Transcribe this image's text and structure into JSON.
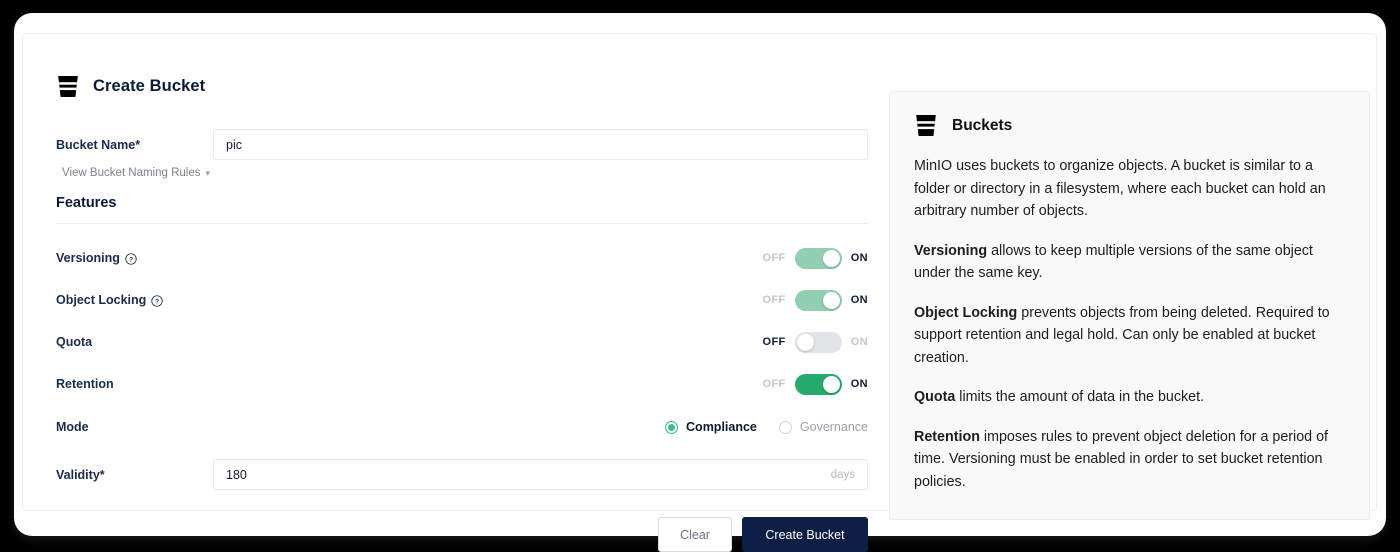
{
  "form": {
    "icon": "bucket-icon",
    "title": "Create Bucket",
    "bucket_name": {
      "label": "Bucket Name*",
      "value": "pic"
    },
    "naming_rules_link": "View Bucket Naming Rules",
    "features_title": "Features",
    "toggles": [
      {
        "label": "Versioning",
        "has_help_icon": true,
        "off_label": "OFF",
        "on_label": "ON",
        "state": "on",
        "disabled": true
      },
      {
        "label": "Object Locking",
        "has_help_icon": true,
        "off_label": "OFF",
        "on_label": "ON",
        "state": "on",
        "disabled": true
      },
      {
        "label": "Quota",
        "has_help_icon": false,
        "off_label": "OFF",
        "on_label": "ON",
        "state": "off",
        "disabled": false
      },
      {
        "label": "Retention",
        "has_help_icon": false,
        "off_label": "OFF",
        "on_label": "ON",
        "state": "on",
        "disabled": false
      }
    ],
    "mode": {
      "label": "Mode",
      "options": [
        {
          "label": "Compliance",
          "selected": true
        },
        {
          "label": "Governance",
          "selected": false
        }
      ]
    },
    "validity": {
      "label": "Validity*",
      "value": "180",
      "suffix": "days"
    },
    "buttons": {
      "clear": "Clear",
      "create": "Create Bucket"
    }
  },
  "info": {
    "icon": "bucket-icon",
    "title": "Buckets",
    "paragraphs": [
      {
        "bold": "",
        "text": "MinIO uses buckets to organize objects. A bucket is similar to a folder or directory in a filesystem, where each bucket can hold an arbitrary number of objects."
      },
      {
        "bold": "Versioning",
        "text": " allows to keep multiple versions of the same object under the same key."
      },
      {
        "bold": "Object Locking",
        "text": " prevents objects from being deleted. Required to support retention and legal hold. Can only be enabled at bucket creation."
      },
      {
        "bold": "Quota",
        "text": " limits the amount of data in the bucket."
      },
      {
        "bold": "Retention",
        "text": " imposes rules to prevent object deletion for a period of time. Versioning must be enabled in order to set bucket retention policies."
      }
    ]
  },
  "colors": {
    "accent_green": "#26a96c",
    "accent_green_disabled": "#92cfb2",
    "primary_navy": "#0d1f45",
    "panel_bg": "#f9f9f9",
    "page_bg": "#000000"
  }
}
